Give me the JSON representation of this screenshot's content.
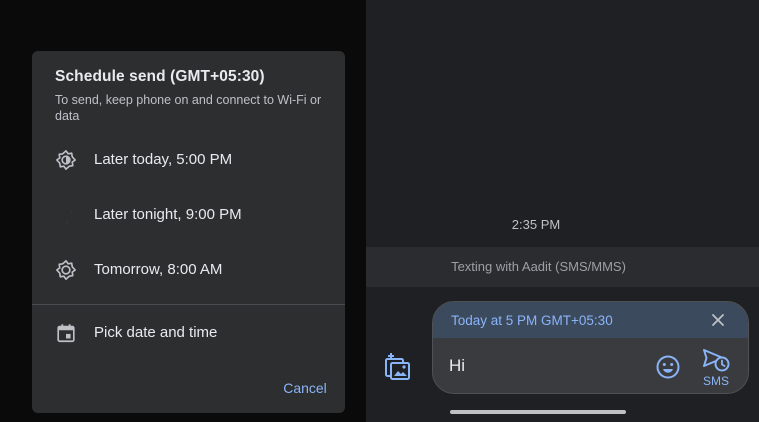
{
  "dialog": {
    "title": "Schedule send (GMT+05:30)",
    "subtitle": "To send, keep phone on and connect to Wi-Fi or data",
    "options": [
      {
        "label": "Later today, 5:00 PM",
        "icon": "sun-dim-icon"
      },
      {
        "label": "Later tonight, 9:00 PM",
        "icon": "moon-icon"
      },
      {
        "label": "Tomorrow, 8:00 AM",
        "icon": "sun-icon"
      },
      {
        "label": "Pick date and time",
        "icon": "calendar-icon"
      }
    ],
    "cancel_label": "Cancel"
  },
  "conversation": {
    "timestamp": "2:35 PM",
    "info_bar": "Texting with Aadit (SMS/MMS)"
  },
  "compose": {
    "scheduled_label": "Today at 5 PM GMT+05:30",
    "message_text": "Hi",
    "send_label": "SMS"
  },
  "colors": {
    "accent": "#8ab4f8",
    "dialog_bg": "#2d2e30",
    "panel_bg": "#1f2023"
  }
}
